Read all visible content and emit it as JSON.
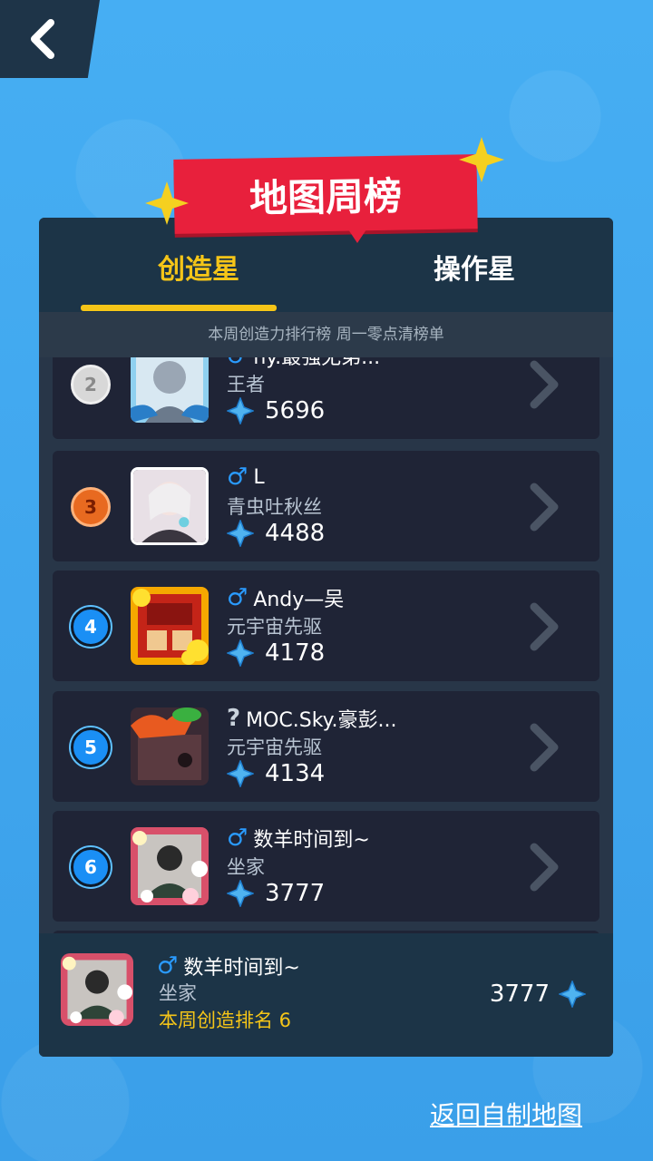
{
  "header": {
    "back_icon": "chevron-left-icon",
    "title": "地图周榜"
  },
  "tabs": [
    {
      "label": "创造星",
      "active": true
    },
    {
      "label": "操作星",
      "active": false
    }
  ],
  "subtitle": "本周创造力排行榜 周一零点清榜单",
  "rows": [
    {
      "rank": "2",
      "gender": "♂",
      "name": "ny.最强无弟...",
      "title": "王者",
      "score": "5696"
    },
    {
      "rank": "3",
      "gender": "♂",
      "name": "L",
      "title": "青虫吐秋丝",
      "score": "4488"
    },
    {
      "rank": "4",
      "gender": "♂",
      "name": "Andy—吴",
      "title": "元宇宙先驱",
      "score": "4178"
    },
    {
      "rank": "5",
      "gender": "?",
      "name": "MOC.Sky.豪彭...",
      "title": "元宇宙先驱",
      "score": "4134"
    },
    {
      "rank": "6",
      "gender": "♂",
      "name": "数羊时间到~",
      "title": "坐家",
      "score": "3777"
    }
  ],
  "me": {
    "gender": "♂",
    "name": "数羊时间到~",
    "title": "坐家",
    "rank_text": "本周创造排名 6",
    "score": "3777"
  },
  "footer": {
    "return_label": "返回自制地图"
  },
  "colors": {
    "accent": "#f5c518",
    "banner": "#e8203c",
    "panel": "#1f3044",
    "gender_male": "#2a9bff"
  }
}
